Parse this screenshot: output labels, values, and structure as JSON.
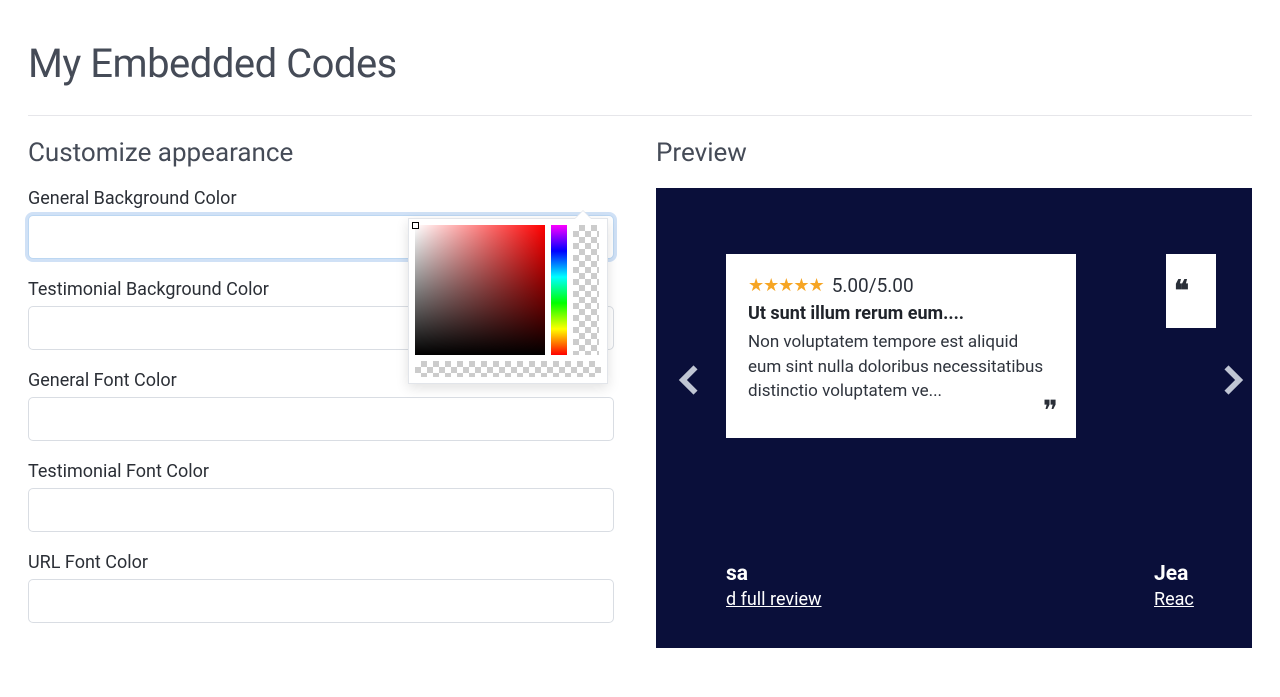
{
  "page": {
    "title": "My Embedded Codes"
  },
  "sections": {
    "customize_title": "Customize appearance",
    "preview_title": "Preview"
  },
  "fields": {
    "general_bg": {
      "label": "General Background Color",
      "value": ""
    },
    "testimonial_bg": {
      "label": "Testimonial Background Color",
      "value": ""
    },
    "general_font": {
      "label": "General Font Color",
      "value": ""
    },
    "testimonial_font": {
      "label": "Testimonial Font Color",
      "value": ""
    },
    "url_font": {
      "label": "URL Font Color",
      "value": ""
    }
  },
  "preview": {
    "rating_text": "5.00/5.00",
    "review_title": "Ut sunt illum rerum eum....",
    "review_body": "Non voluptatem tempore est aliquid eum sint nulla doloribus necessitatibus distinctio voluptatem ve...",
    "left_name_fragment": "sa",
    "left_link_fragment": "d full review",
    "right_name_fragment": "Jea",
    "right_link_fragment": "Reac"
  }
}
